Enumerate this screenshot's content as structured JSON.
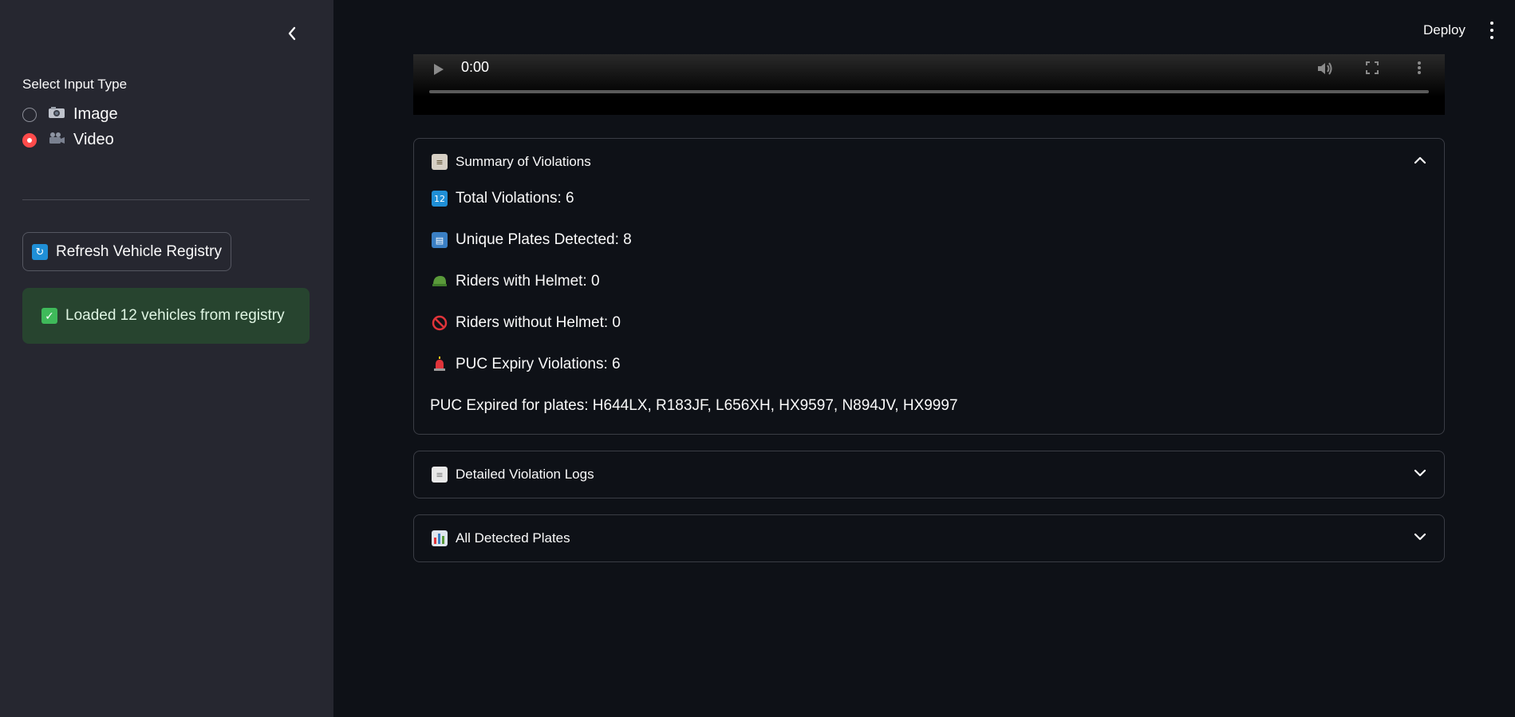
{
  "sidebar": {
    "input_type_label": "Select Input Type",
    "options": [
      {
        "icon": "camera-icon",
        "label": "Image",
        "selected": false
      },
      {
        "icon": "video-camera-icon",
        "label": "Video",
        "selected": true
      }
    ],
    "refresh_label": "Refresh Vehicle Registry",
    "success_message": "Loaded 12 vehicles from registry"
  },
  "topbar": {
    "deploy_label": "Deploy"
  },
  "video": {
    "time": "0:00"
  },
  "summary": {
    "title": "Summary of Violations",
    "total_violations": "Total Violations: 6",
    "unique_plates": "Unique Plates Detected: 8",
    "riders_with_helmet": "Riders with Helmet: 0",
    "riders_without_helmet": "Riders without Helmet: 0",
    "puc_expiry": "PUC Expiry Violations: 6",
    "puc_plates": "PUC Expired for plates: H644LX, R183JF, L656XH, HX9597, N894JV, HX9997"
  },
  "expanders": {
    "logs_title": "Detailed Violation Logs",
    "plates_title": "All Detected Plates"
  },
  "colors": {
    "accent": "#ff4b4b",
    "background": "#0e1117",
    "sidebar": "#262730",
    "success_bg": "#27442f"
  }
}
